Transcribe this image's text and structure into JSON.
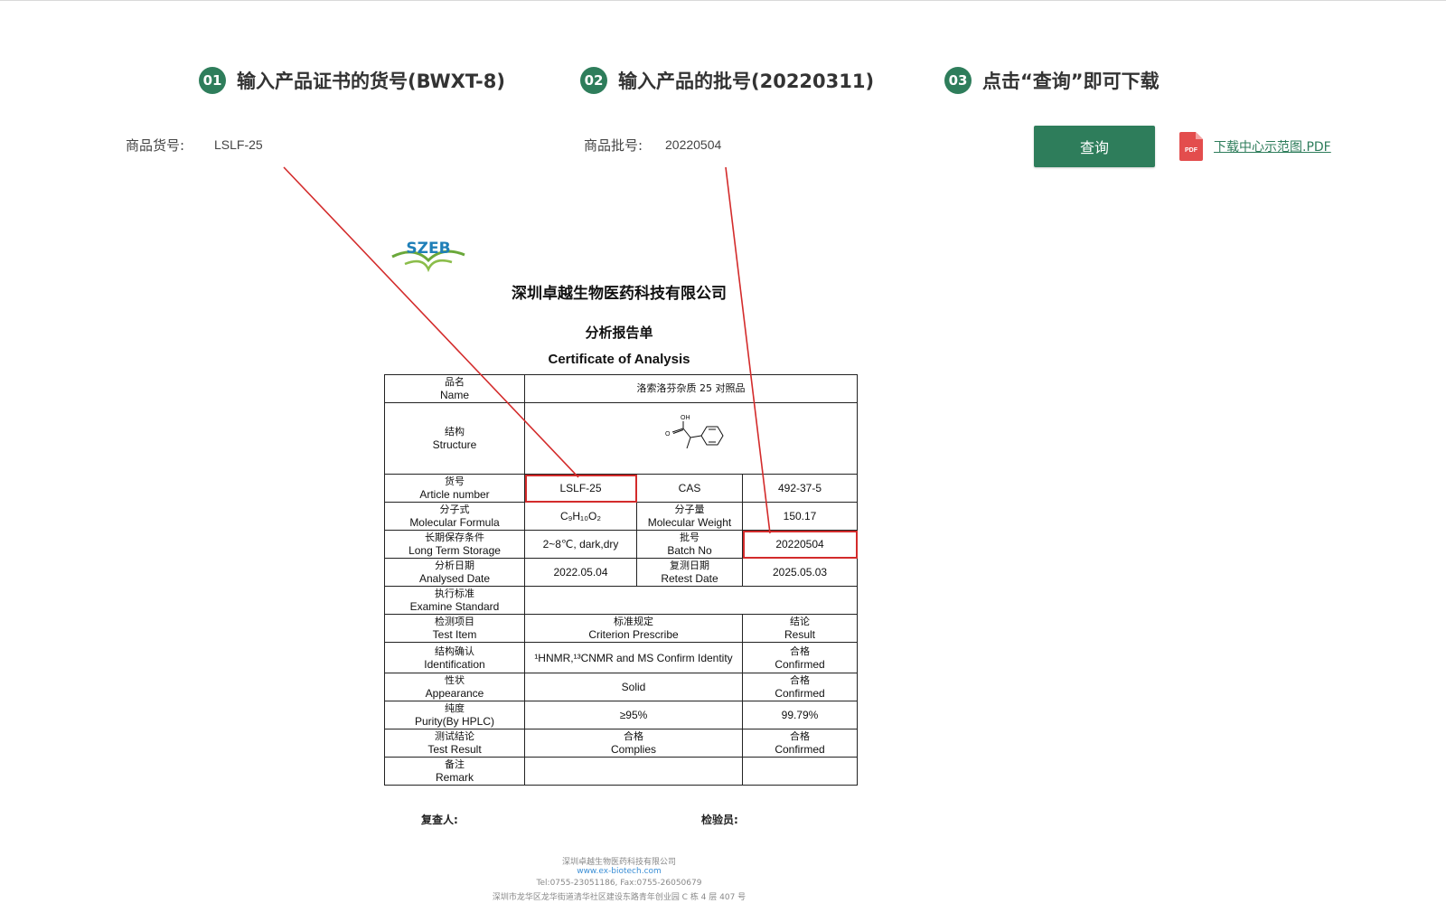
{
  "steps": [
    {
      "number": "01",
      "text": "输入产品证书的货号(BWXT-8)"
    },
    {
      "number": "02",
      "text": "输入产品的批号(20220311)"
    },
    {
      "number": "03",
      "text": "点击“查询”即可下载"
    }
  ],
  "form": {
    "article_label": "商品货号:",
    "article_value": "LSLF-25",
    "batch_label": "商品批号:",
    "batch_value": "20220504",
    "query_button": "查询",
    "pdf_link": "下载中心示范图.PDF",
    "pdf_icon_text": "PDF"
  },
  "certificate": {
    "logo_text": "SZEB",
    "company": "深圳卓越生物医药科技有限公司",
    "title_cn": "分析报告单",
    "title_en": "Certificate of Analysis",
    "name_cn": "品名",
    "name_en": "Name",
    "product_name": "洛索洛芬杂质 25 对照品",
    "structure_cn": "结构",
    "structure_en": "Structure",
    "structure_oh": "OH",
    "structure_o": "O",
    "article_cn": "货号",
    "article_en": "Article number",
    "article_value": "LSLF-25",
    "cas_label": "CAS",
    "cas_value": "492-37-5",
    "formula_cn": "分子式",
    "formula_en": "Molecular Formula",
    "formula_value": "C₉H₁₀O₂",
    "mw_cn": "分子量",
    "mw_en": "Molecular Weight",
    "mw_value": "150.17",
    "storage_cn": "长期保存条件",
    "storage_en": "Long Term Storage",
    "storage_value": "2~8℃, dark,dry",
    "batch_cn": "批号",
    "batch_en": "Batch No",
    "batch_value": "20220504",
    "analysed_cn": "分析日期",
    "analysed_en": "Analysed Date",
    "analysed_value": "2022.05.04",
    "retest_cn": "复测日期",
    "retest_en": "Retest Date",
    "retest_value": "2025.05.03",
    "standard_cn": "执行标准",
    "standard_en": "Examine Standard",
    "test_item_cn": "检测项目",
    "test_item_en": "Test Item",
    "criterion_cn": "标准规定",
    "criterion_en": "Criterion Prescribe",
    "result_cn": "结论",
    "result_en": "Result",
    "ident_cn": "结构确认",
    "ident_en": "Identification",
    "ident_value": "¹HNMR,¹³CNMR and MS Confirm Identity",
    "ident_result_cn": "合格",
    "ident_result_en": "Confirmed",
    "appearance_cn": "性状",
    "appearance_en": "Appearance",
    "appearance_value": "Solid",
    "appearance_result_cn": "合格",
    "appearance_result_en": "Confirmed",
    "purity_cn": "纯度",
    "purity_en": "Purity(By HPLC)",
    "purity_value": "≥95%",
    "purity_result": "99.79%",
    "testresult_cn": "测试结论",
    "testresult_en": "Test Result",
    "testresult_value_cn": "合格",
    "testresult_value_en": "Complies",
    "testresult_result_cn": "合格",
    "testresult_result_en": "Confirmed",
    "remark_cn": "备注",
    "remark_en": "Remark",
    "reviewer_label": "复查人:",
    "inspector_label": "检验员:",
    "footer_company": "深圳卓越生物医药科技有限公司",
    "footer_web": "www.ex-biotech.com",
    "footer_contact": "Tel:0755-23051186, Fax:0755-26050679",
    "footer_address": "深圳市龙华区龙华街道清华社区建设东路青年创业园 C 栋 4 层 407 号"
  },
  "colors": {
    "accent": "#2e7d5b",
    "highlight": "#d32b2b",
    "pdf_red": "#e34d4d"
  }
}
